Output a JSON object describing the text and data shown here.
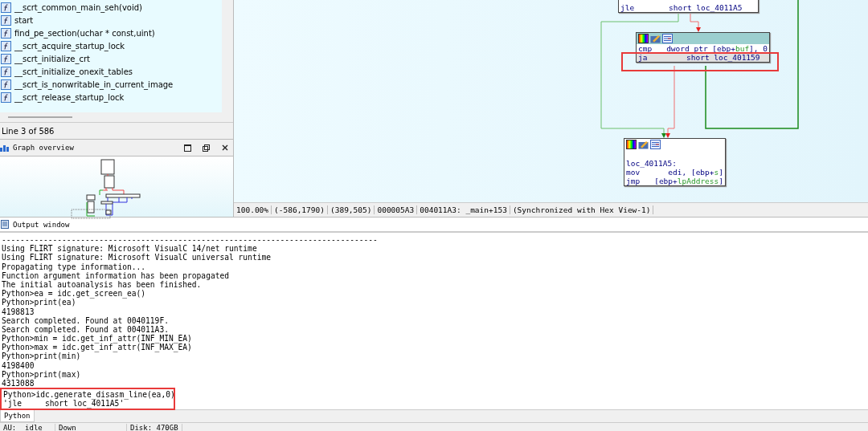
{
  "functions": {
    "items": [
      {
        "name": "__scrt_common_main_seh(void)"
      },
      {
        "name": "start"
      },
      {
        "name": "find_pe_section(uchar * const,uint)"
      },
      {
        "name": "__scrt_acquire_startup_lock"
      },
      {
        "name": "__scrt_initialize_crt"
      },
      {
        "name": "__scrt_initialize_onexit_tables"
      },
      {
        "name": "__scrt_is_nonwritable_in_current_image"
      },
      {
        "name": "__scrt_release_startup_lock"
      }
    ],
    "status": "Line 3 of 586"
  },
  "graph_overview": {
    "title": "Graph overview"
  },
  "graph": {
    "nodes": [
      {
        "kind": "top",
        "lines": [
          {
            "op": "jle",
            "args": [
              "short loc_4011A5"
            ],
            "selected": false
          }
        ]
      },
      {
        "kind": "mid",
        "lines": [
          {
            "op": "cmp",
            "args": [
              "dword ptr [ebp+",
              "buf",
              "], 0"
            ],
            "selected": false
          },
          {
            "op": "ja",
            "args": [
              "short loc_401159"
            ],
            "selected": true
          }
        ]
      },
      {
        "kind": "bottom",
        "label": "loc_4011A5:",
        "lines": [
          {
            "op": "mov",
            "args": [
              "edi, [ebp+",
              "s",
              "]"
            ],
            "selected": false
          },
          {
            "op": "jmp",
            "args": [
              "[ebp+",
              "lpAddress",
              "]"
            ],
            "selected": false
          }
        ]
      }
    ],
    "status": [
      "100.00%",
      "(-586,1790)",
      "(389,505)",
      "000005A3",
      "004011A3: _main+153",
      "(Synchronized with Hex View-1)"
    ]
  },
  "output": {
    "title": "Output window",
    "lines": [
      {
        "text": "---------------------------------------------------------------------------------",
        "framed": false
      },
      {
        "text": "Using FLIRT signature: Microsoft VisualC 14/net runtime",
        "framed": false
      },
      {
        "text": "Using FLIRT signature: Microsoft VisualC universal runtime",
        "framed": false
      },
      {
        "text": "Propagating type information...",
        "framed": false
      },
      {
        "text": "Function argument information has been propagated",
        "framed": false
      },
      {
        "text": "The initial autoanalysis has been finished.",
        "framed": false
      },
      {
        "text": "Python>ea = idc.get_screen_ea()",
        "framed": false
      },
      {
        "text": "Python>print(ea)",
        "framed": false
      },
      {
        "text": "4198813",
        "framed": false
      },
      {
        "text": "Search completed. Found at 0040119F.",
        "framed": false
      },
      {
        "text": "Search completed. Found at 004011A3.",
        "framed": false
      },
      {
        "text": "Python>min = idc.get_inf_attr(INF_MIN_EA)",
        "framed": false
      },
      {
        "text": "Python>max = idc.get_inf_attr(INF_MAX_EA)",
        "framed": false
      },
      {
        "text": "Python>print(min)",
        "framed": false
      },
      {
        "text": "4198400",
        "framed": false
      },
      {
        "text": "Python>print(max)",
        "framed": false
      },
      {
        "text": "4313088",
        "framed": false
      },
      {
        "text": "Python>idc.generate_disasm_line(ea,0)",
        "framed": true
      },
      {
        "text": "'jle     short loc_4011A5'",
        "framed": true
      }
    ],
    "tab": "Python"
  },
  "status_bar": [
    "AU:  idle",
    "Down",
    "Disk: 470GB"
  ]
}
